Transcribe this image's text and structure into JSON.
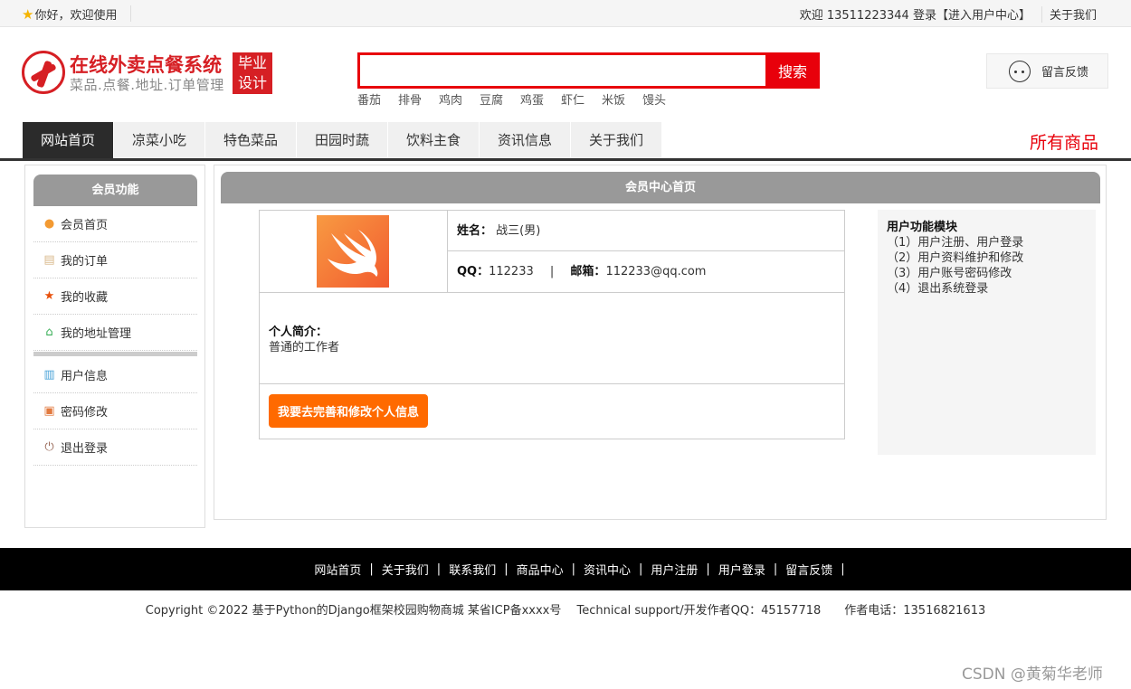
{
  "topbar": {
    "welcome": "你好，欢迎使用",
    "user_greeting": "欢迎 13511223344 登录",
    "user_center_link": "【进入用户中心】",
    "about": "关于我们"
  },
  "logo": {
    "title": "在线外卖点餐系统",
    "subtitle": "菜品.点餐.地址.订单管理",
    "badge_line1": "毕业",
    "badge_line2": "设计"
  },
  "search": {
    "value": "",
    "button_label": "搜索",
    "hot_words": [
      "番茄",
      "排骨",
      "鸡肉",
      "豆腐",
      "鸡蛋",
      "虾仁",
      "米饭",
      "馒头"
    ]
  },
  "feedback_label": "留言反馈",
  "nav": {
    "items": [
      "网站首页",
      "凉菜小吃",
      "特色菜品",
      "田园时蔬",
      "饮料主食",
      "资讯信息",
      "关于我们"
    ],
    "all_goods": "所有商品"
  },
  "sidebar": {
    "title": "会员功能",
    "items": [
      {
        "label": "会员首页",
        "icon": "home-icon",
        "color": "#f39a32"
      },
      {
        "label": "我的订单",
        "icon": "order-icon",
        "color": "#d9b98c"
      },
      {
        "label": "我的收藏",
        "icon": "star-icon",
        "color": "#e8500b"
      },
      {
        "label": "我的地址管理",
        "icon": "map-pin-icon",
        "color": "#3cb05a"
      },
      {
        "label": "用户信息",
        "icon": "clipboard-icon",
        "color": "#4aa3d8"
      },
      {
        "label": "密码修改",
        "icon": "lock-icon",
        "color": "#e27a3f"
      },
      {
        "label": "退出登录",
        "icon": "power-icon",
        "color": "#9a6a5a"
      }
    ]
  },
  "main": {
    "title": "会员中心首页",
    "profile": {
      "name_label": "姓名：",
      "name_value": "战三(男)",
      "qq_label": "QQ：",
      "qq_value": "112233",
      "divider": "|",
      "email_label": "邮箱：",
      "email_value": "112233@qq.com",
      "bio_label": "个人简介：",
      "bio_value": "普通的工作者",
      "edit_button": "我要去完善和修改个人信息"
    },
    "modules": {
      "title": "用户功能模块",
      "items": [
        "（1）用户注册、用户登录",
        "（2）用户资料维护和修改",
        "（3）用户账号密码修改",
        "（4）退出系统登录"
      ]
    }
  },
  "footer": {
    "links": [
      "网站首页",
      "关于我们",
      "联系我们",
      "商品中心",
      "资讯中心",
      "用户注册",
      "用户登录",
      "留言反馈"
    ],
    "separator": "|",
    "copyright": "Copyright ©2022 基于Python的Django框架校园购物商城 某省ICP备xxxx号　 Technical support/开发作者QQ：45157718　　作者电话：13516821613"
  },
  "watermark": "CSDN @黄菊华老师",
  "colors": {
    "brand_red": "#d61f24",
    "search_red": "#e8000b",
    "button_orange": "#ff6a00",
    "nav_active": "#2b2b2b"
  }
}
